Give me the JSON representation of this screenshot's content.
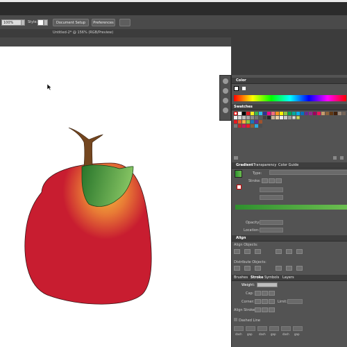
{
  "control_bar": {
    "zoom_value": "100%",
    "style_label": "Style:",
    "document_setup_button": "Document Setup",
    "preferences_button": "Preferences"
  },
  "document_tab": {
    "title": "Untitled-2* @ 156% (RGB/Preview)"
  },
  "panels": {
    "color": {
      "title": "Color"
    },
    "swatches": {
      "title": "Swatches"
    },
    "gradient": {
      "tabs": [
        "Gradient",
        "Transparency",
        "Color Guide"
      ],
      "type_label": "Type:",
      "stroke_label": "Stroke:",
      "opacity_label": "Opacity:",
      "location_label": "Location:"
    },
    "align": {
      "title": "Align",
      "align_objects_label": "Align Objects:",
      "distribute_objects_label": "Distribute Objects:"
    },
    "stroke": {
      "tabs": [
        "Brushes",
        "Stroke",
        "Symbols",
        "Layers"
      ],
      "weight_label": "Weight:",
      "cap_label": "Cap:",
      "corner_label": "Corner:",
      "limit_label": "Limit:",
      "align_stroke_label": "Align Stroke:",
      "dashed_line_label": "Dashed Line",
      "dash_labels": [
        "dash",
        "gap",
        "dash",
        "gap",
        "dash",
        "gap"
      ]
    }
  },
  "colors": {
    "apple_red": "#c81d30",
    "apple_highlight": "#f1b43a",
    "leaf_dark": "#2b7a2b",
    "leaf_light": "#7fc060",
    "stem": "#74461f",
    "gradient_bar_start": "#2e8f2e",
    "gradient_bar_end": "#6cbf50"
  },
  "icons": {
    "cursor": "arrow-cursor-icon"
  }
}
